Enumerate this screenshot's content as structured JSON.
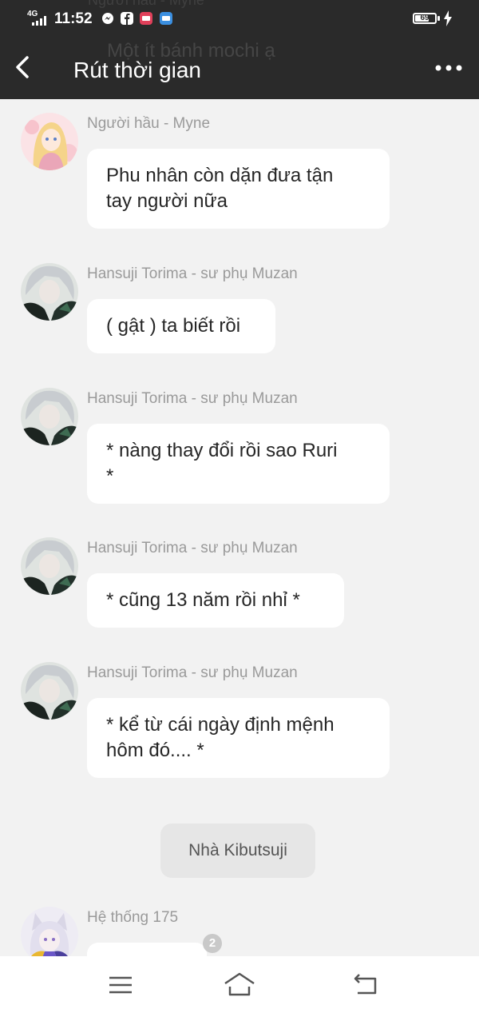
{
  "status_bar": {
    "network": "4G",
    "time": "11:52",
    "battery": "69",
    "battery_level": 0.69
  },
  "header": {
    "title": "Rút thời gian",
    "ghost_text": "Một ít bánh mochi ạ",
    "ghost_sender": "Người hầu - Myne"
  },
  "messages": [
    {
      "sender": "Người hầu - Myne",
      "text_lines": [
        "Phu nhân còn dặn đưa tận",
        "tay người nữa"
      ]
    },
    {
      "sender": "Hansuji Torima - sư phụ Muzan",
      "text_lines": [
        "( gật ) ta biết rồi"
      ]
    },
    {
      "sender": "Hansuji Torima - sư phụ Muzan",
      "text_lines": [
        "* nàng thay đổi rồi sao Ruri",
        "*"
      ]
    },
    {
      "sender": "Hansuji Torima - sư phụ Muzan",
      "text_lines": [
        "* cũng 13 năm rồi nhỉ *"
      ]
    },
    {
      "sender": "Hansuji Torima - sư phụ Muzan",
      "text_lines": [
        "* kể từ cái ngày định mệnh",
        "hôm đó.... *"
      ]
    },
    {
      "sender": "Hệ thống 175",
      "text_lines": [
        ""
      ]
    }
  ],
  "scene_label": "Nhà Kibutsuji",
  "unread_badge": "2",
  "nav": {
    "menu_icon": "menu-icon",
    "home_icon": "home-icon",
    "back_icon": "back-icon"
  },
  "colors": {
    "header_bg": "#2a2a2a",
    "chat_bg": "#f2f2f2",
    "bubble_bg": "#ffffff",
    "sender_text": "#9a9a9a"
  }
}
